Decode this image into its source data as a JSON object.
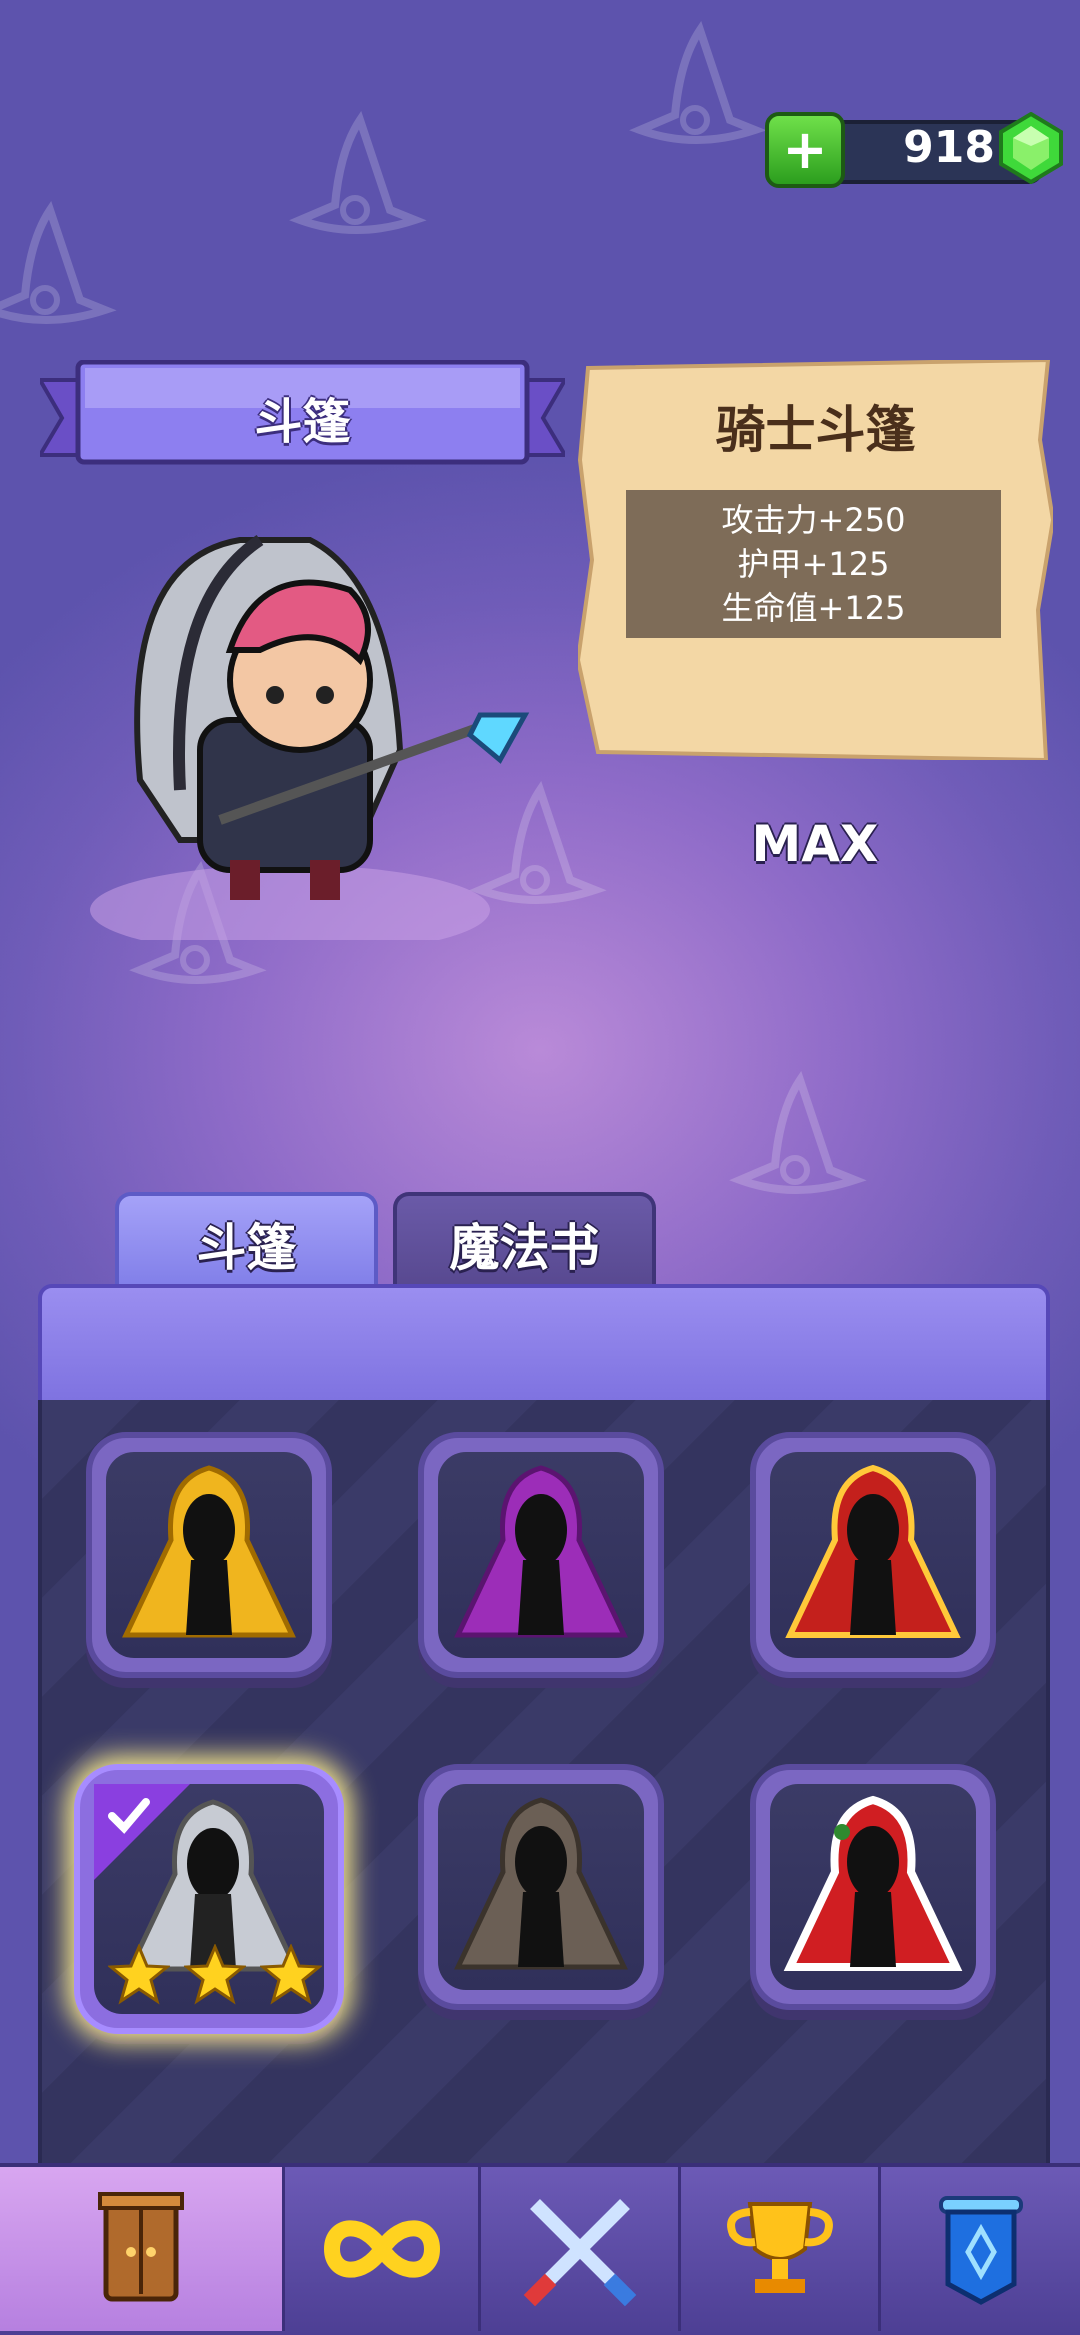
{
  "currency": {
    "add_icon": "plus-icon",
    "amount": "918",
    "gem_icon": "green-gem-icon"
  },
  "banner": {
    "label": "斗篷"
  },
  "item_info": {
    "name": "骑士斗篷",
    "stats": [
      "攻击力+250",
      "护甲+125",
      "生命值+125"
    ],
    "level_status": "MAX"
  },
  "tabs": [
    {
      "label": "斗篷",
      "active": true
    },
    {
      "label": "魔法书",
      "active": false
    }
  ],
  "cloaks": [
    {
      "icon": "yellow-cloak-icon",
      "selected": false
    },
    {
      "icon": "purple-cloak-icon",
      "selected": false
    },
    {
      "icon": "red-gold-cloak-icon",
      "selected": false
    },
    {
      "icon": "knight-cloak-icon",
      "selected": true,
      "stars": 3
    },
    {
      "icon": "stone-cloak-icon",
      "selected": false
    },
    {
      "icon": "christmas-cloak-icon",
      "selected": false
    }
  ],
  "nav": [
    {
      "icon": "wardrobe-icon",
      "active": true
    },
    {
      "icon": "infinity-icon",
      "active": false
    },
    {
      "icon": "crossed-swords-icon",
      "active": false
    },
    {
      "icon": "trophy-icon",
      "active": false
    },
    {
      "icon": "banner-scroll-icon",
      "active": false
    }
  ],
  "colors": {
    "accent": "#7f7de8",
    "panel": "#3a3a68",
    "gem": "#3fd93a",
    "gold": "#ffd21f"
  }
}
